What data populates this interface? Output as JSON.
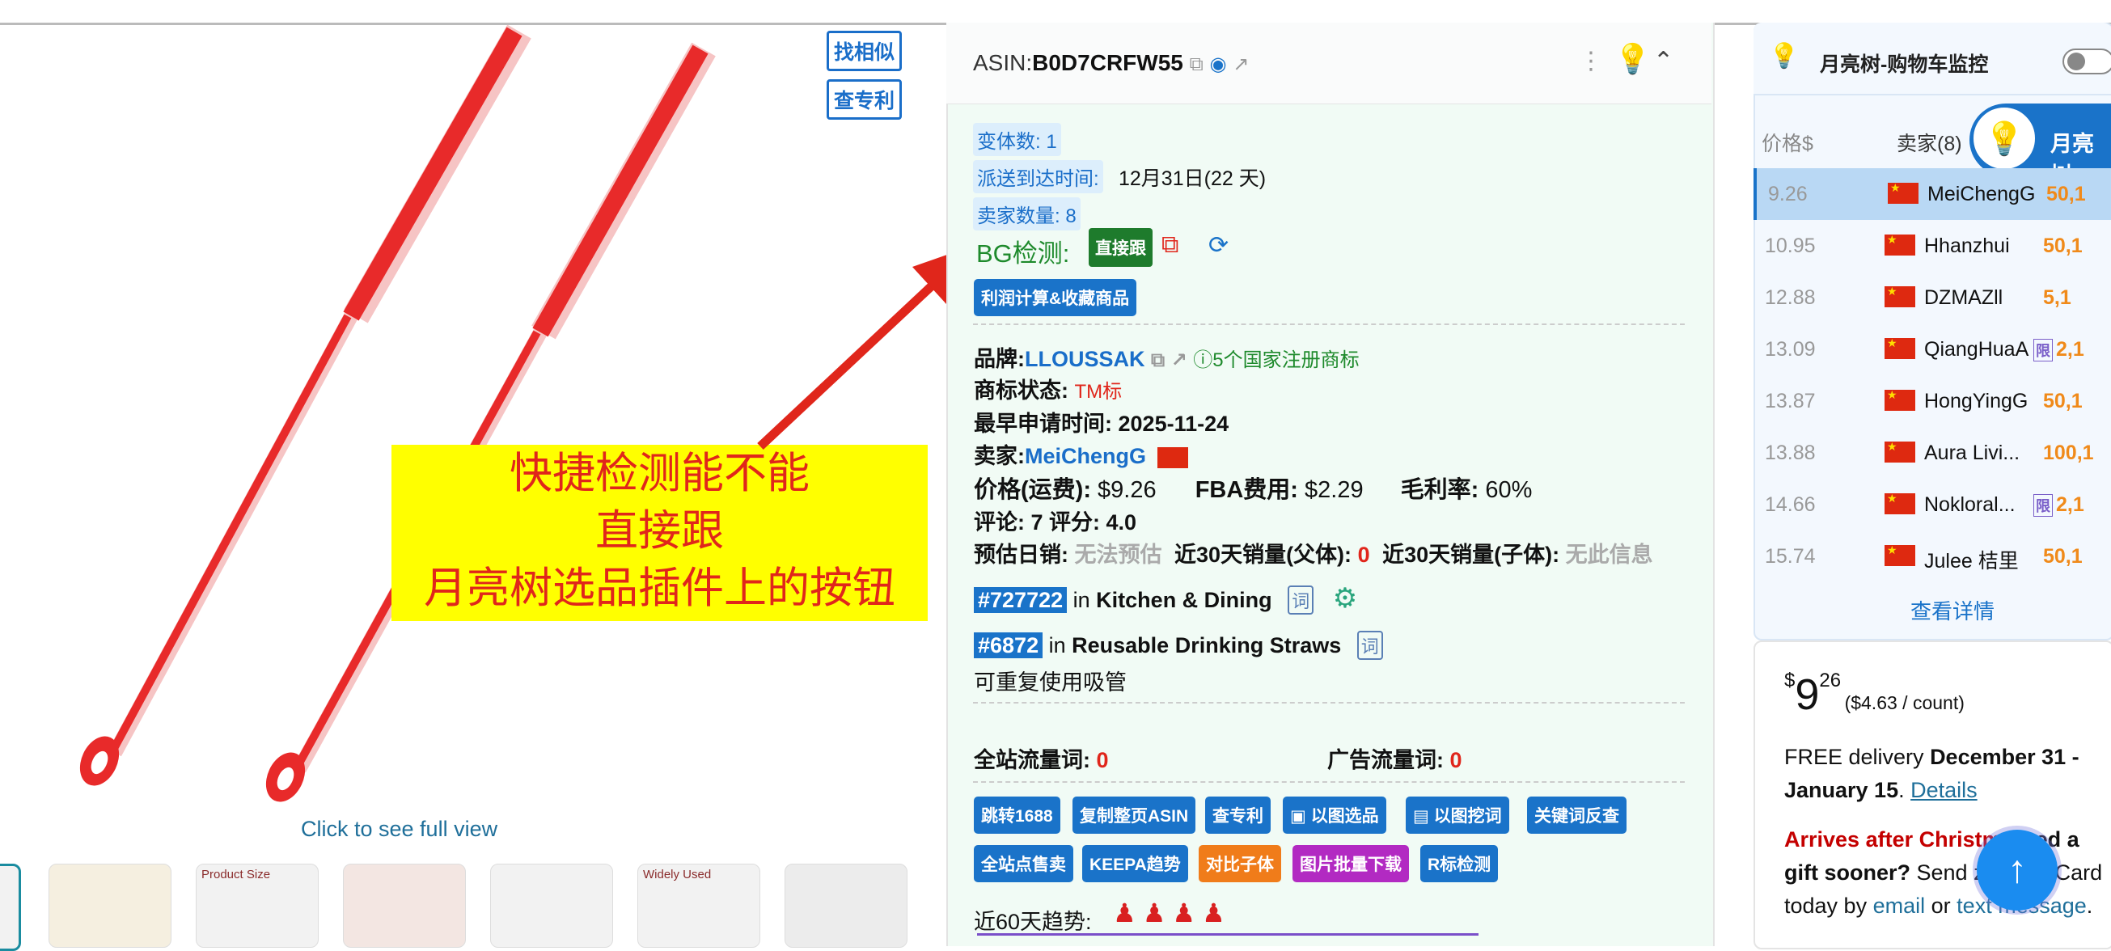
{
  "image_area": {
    "find_similar": "找相似",
    "check_patent": "查专利",
    "full_view": "Click to see full view",
    "thumb_labels": [
      "Product Size",
      "Widely Used"
    ]
  },
  "annotation": {
    "line1": "快捷检测能不能",
    "line2": "直接跟",
    "line3": "月亮树选品插件上的按钮"
  },
  "product_panel": {
    "asin_label": "ASIN:",
    "asin": "B0D7CRFW55",
    "variants": "变体数: 1",
    "delivery_label": "派送到达时间:",
    "delivery_value": "12月31日(22 天)",
    "sellers_count": "卖家数量: 8",
    "bg_label": "BG检测:",
    "direct_follow": "直接跟",
    "profit_button": "利润计算&收藏商品",
    "brand_label": "品牌:",
    "brand": "LLOUSSAK",
    "trademark_count": "5个国家注册商标",
    "tm_status_label": "商标状态:",
    "tm_status": "TM标",
    "earliest_label": "最早申请时间:",
    "earliest_date": "2025-11-24",
    "seller_label": "卖家:",
    "seller": "MeiChengG",
    "price_label": "价格(运费):",
    "price": "$9.26",
    "fba_label": "FBA费用:",
    "fba": "$2.29",
    "margin_label": "毛利率:",
    "margin": "60%",
    "reviews": "评论: 7  评分: 4.0",
    "daily_label": "预估日销:",
    "daily": "无法预估",
    "sales_parent_label": "近30天销量(父体):",
    "sales_parent": "0",
    "sales_child_label": "近30天销量(子体):",
    "sales_child": "无此信息",
    "rank1_num": "#727722",
    "rank1_in": "in",
    "rank1_cat": "Kitchen & Dining",
    "rank2_num": "#6872",
    "rank2_in": "in",
    "rank2_cat": "Reusable Drinking Straws",
    "word_icon": "词",
    "subcat_cn": "可重复使用吸管",
    "traffic_label": "全站流量词:",
    "traffic": "0",
    "ad_traffic_label": "广告流量词:",
    "ad_traffic": "0",
    "tools_row1": [
      "跳转1688",
      "复制整页ASIN",
      "查专利",
      "以图选品",
      "以图挖词",
      "关键词反查"
    ],
    "tools_row2": [
      "全站点售卖",
      "KEEPA趋势",
      "对比子体",
      "图片批量下载",
      "R标检测"
    ],
    "trend_label": "近60天趋势:"
  },
  "right_panel": {
    "header": "月亮树-购物车监控",
    "col_price": "价格$",
    "col_sellers": "卖家(8)",
    "brand_badge": "月亮树",
    "rows": [
      {
        "price": "9.26",
        "name": "MeiChengG",
        "rating": "50,1",
        "limited": false
      },
      {
        "price": "10.95",
        "name": "Hhanzhui",
        "rating": "50,1",
        "limited": false
      },
      {
        "price": "12.88",
        "name": "DZMAZll",
        "rating": "5,1",
        "limited": false
      },
      {
        "price": "13.09",
        "name": "QiangHuaA",
        "rating": "2,1",
        "limited": true
      },
      {
        "price": "13.87",
        "name": "HongYingG",
        "rating": "50,1",
        "limited": false
      },
      {
        "price": "13.88",
        "name": "Aura Livi...",
        "rating": "100,1",
        "limited": false
      },
      {
        "price": "14.66",
        "name": "Nokloral...",
        "rating": "2,1",
        "limited": true
      },
      {
        "price": "15.74",
        "name": "Julee 桔里",
        "rating": "50,1",
        "limited": false
      }
    ],
    "limited_tag": "限",
    "details_link": "查看详情"
  },
  "buy_box": {
    "price_symbol": "$",
    "price_whole": "9",
    "price_fraction": "26",
    "price_per": "($4.63 / count)",
    "delivery_prefix": "FREE delivery",
    "delivery_dates": "December 31 - January 15",
    "delivery_period": ".",
    "details_link": "Details",
    "arrives_after": "Arrives after Christm",
    "gift_text1": "Need a",
    "gift_text2": "gift sooner?",
    "gift_text3": "Send",
    "gift_text4": "zon",
    "gift_text5": "Gift Card today by",
    "email": "email",
    "or": "or",
    "text_link": "text",
    "message": "message",
    "message_end": "."
  },
  "colors": {
    "accent_blue": "#1a73c9",
    "annotation_bg": "#ffff00",
    "annotation_text": "#e0261b",
    "arrow": "#e0261b",
    "panel_bg": "#f1fbf5",
    "straw_red": "#e82a2a"
  }
}
